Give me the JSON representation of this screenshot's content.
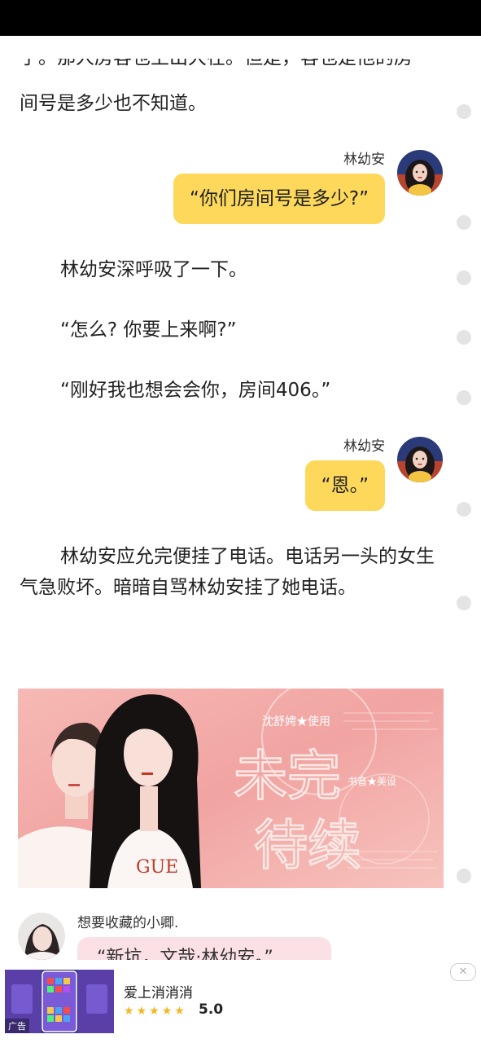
{
  "story": {
    "clipped_top_line": "了。那人房客也上出大在。但是，客也是他的房",
    "para1": "间号是多少也不知道。",
    "dialog1": {
      "speaker": "林幼安",
      "text": "“你们房间号是多少?”"
    },
    "para2": "林幼安深呼吸了一下。",
    "para3": "“怎么? 你要上来啊?”",
    "para4": "“刚好我也想会会你，房间406。”",
    "dialog2": {
      "speaker": "林幼安",
      "text": "“恩。”"
    },
    "para5": "林幼安应允完便挂了电话。电话另一头的女生气急败坏。暗暗自骂林幼安挂了她电话。"
  },
  "banner": {
    "line1": "未完",
    "line2": "待续",
    "credit_top": "沈舒娉★使用",
    "credit_side": "书音★美设",
    "shirt_text": "GUE"
  },
  "comment": {
    "username": "想要收藏的小卿.",
    "text": "“新坑，文哉·林幼安。”"
  },
  "ad": {
    "ad_label": "广告",
    "title": "爱上消消消",
    "stars": 5,
    "rating": "5.0",
    "close_icon": "close-icon"
  },
  "colors": {
    "bubble": "#fdd85a",
    "comment_bubble": "#fbe0e6",
    "star": "#f6b621",
    "banner_pink": "#f3a5a5",
    "status_bar": "#000000"
  }
}
